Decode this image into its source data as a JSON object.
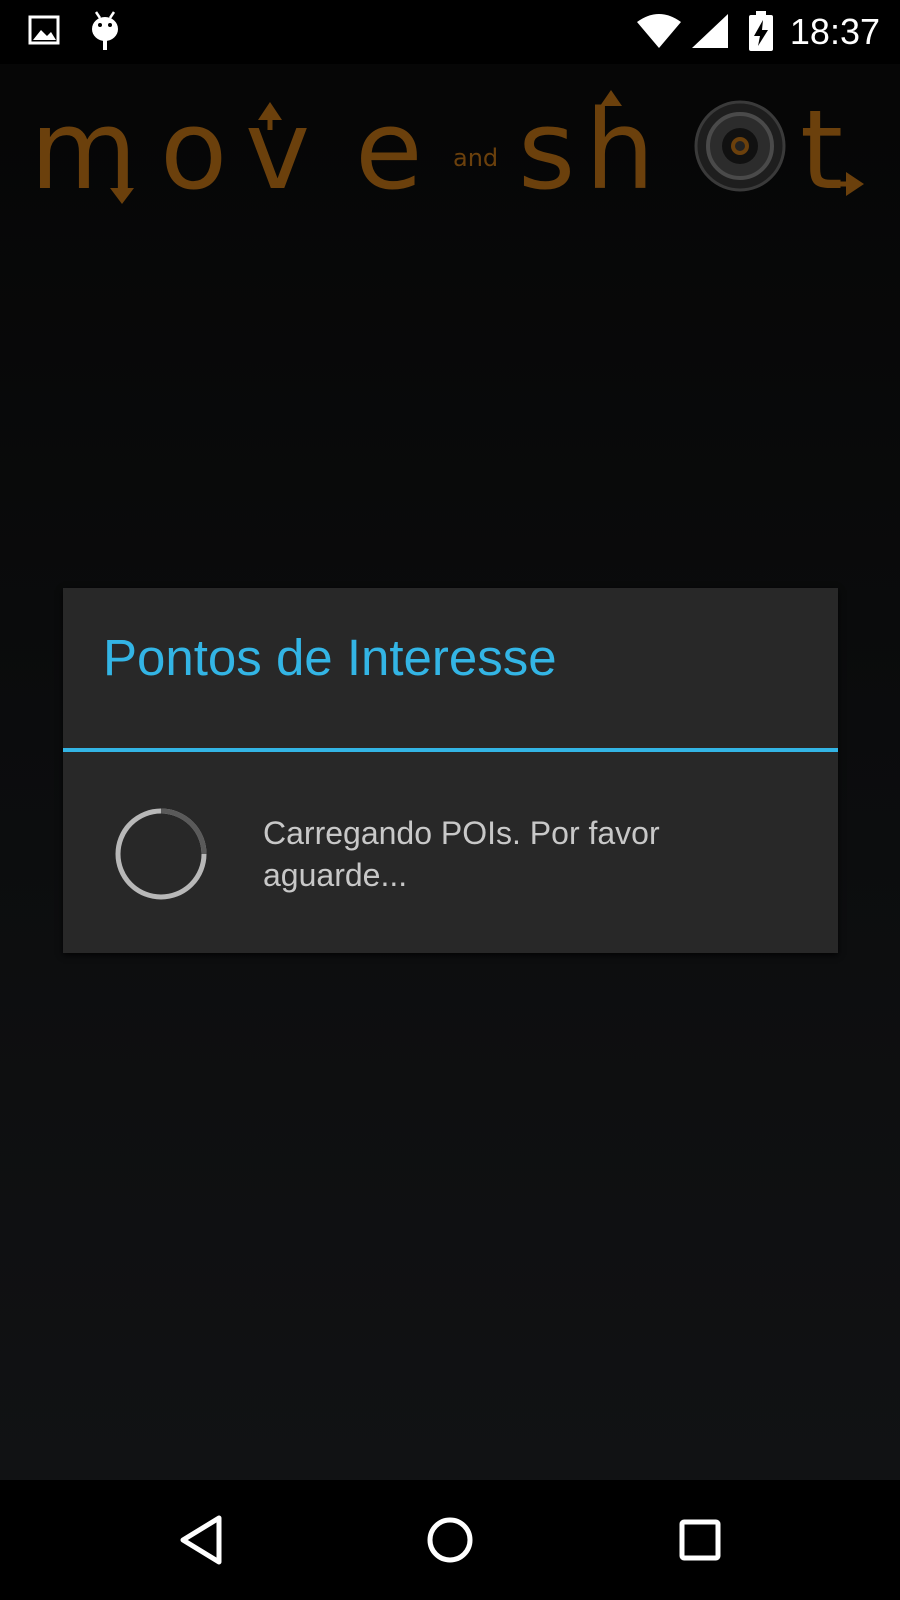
{
  "status_bar": {
    "time": "18:37",
    "icons": [
      "image-notification-icon",
      "android-debug-icon",
      "wifi-icon",
      "cell-signal-icon",
      "battery-charging-icon"
    ]
  },
  "logo": {
    "word1": "move",
    "connector": "and",
    "word2": "shot",
    "brand_color": "#6b400c"
  },
  "dialog": {
    "title": "Pontos de Interesse",
    "message": "Carregando POIs. Por favor aguarde...",
    "accent_color": "#33b5e5"
  },
  "nav_bar": {
    "buttons": [
      "back-icon",
      "home-icon",
      "recents-icon"
    ]
  }
}
